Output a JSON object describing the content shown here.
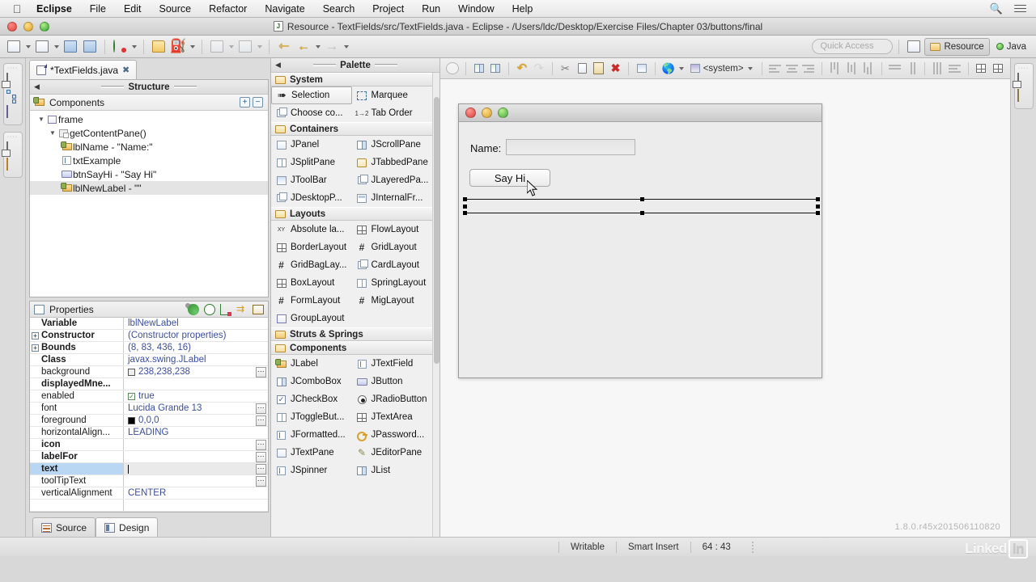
{
  "menubar": {
    "apple": "apple-logo",
    "items": [
      "Eclipse",
      "File",
      "Edit",
      "Source",
      "Refactor",
      "Navigate",
      "Search",
      "Project",
      "Run",
      "Window",
      "Help"
    ],
    "right_icons": [
      "search-icon",
      "list-icon"
    ]
  },
  "window": {
    "title": "Resource - TextFields/src/TextFields.java - Eclipse - /Users/ldc/Desktop/Exercise Files/Chapter 03/buttons/final",
    "file_badge": "J"
  },
  "toolbar": {
    "quick_access_placeholder": "Quick Access",
    "perspectives": [
      {
        "label": "Resource",
        "active": true
      },
      {
        "label": "Java",
        "active": false
      }
    ]
  },
  "editor": {
    "tab_label": "*TextFields.java",
    "close_glyph": "✖",
    "bottom_tabs": [
      {
        "label": "Source",
        "active": false
      },
      {
        "label": "Design",
        "active": true
      }
    ],
    "version": "1.8.0.r45x201506110820"
  },
  "structure": {
    "header": "Structure",
    "view_title": "Components",
    "expand_all": "+",
    "collapse_all": "−",
    "tree": [
      {
        "label": "frame",
        "depth": 0,
        "twisty": "▼",
        "icon": "frame-icon",
        "selected": false
      },
      {
        "label": "getContentPane()",
        "depth": 1,
        "twisty": "▼",
        "icon": "content-pane-icon",
        "selected": false
      },
      {
        "label": "lblName - \"Name:\"",
        "depth": 2,
        "twisty": "",
        "icon": "jlabel-icon",
        "selected": false
      },
      {
        "label": "txtExample",
        "depth": 2,
        "twisty": "",
        "icon": "jtextfield-icon",
        "selected": false
      },
      {
        "label": "btnSayHi - \"Say Hi\"",
        "depth": 2,
        "twisty": "",
        "icon": "jbutton-icon",
        "selected": false
      },
      {
        "label": "lblNewLabel - \"\"",
        "depth": 2,
        "twisty": "",
        "icon": "jlabel-icon",
        "selected": true
      }
    ]
  },
  "properties": {
    "title": "Properties",
    "rows": [
      {
        "name": "Variable",
        "value": "lblNewLabel",
        "bold": true,
        "expand": false,
        "ellipsis": false,
        "widget": "none",
        "selected": false
      },
      {
        "name": "Constructor",
        "value": "(Constructor properties)",
        "bold": true,
        "expand": true,
        "ellipsis": false,
        "widget": "none",
        "selected": false
      },
      {
        "name": "Bounds",
        "value": "(8, 83, 436, 16)",
        "bold": true,
        "expand": true,
        "ellipsis": false,
        "widget": "none",
        "selected": false
      },
      {
        "name": "Class",
        "value": "javax.swing.JLabel",
        "bold": true,
        "expand": false,
        "ellipsis": false,
        "widget": "none",
        "selected": false
      },
      {
        "name": "background",
        "value": "238,238,238",
        "bold": false,
        "expand": false,
        "ellipsis": true,
        "widget": "swatch",
        "selected": false
      },
      {
        "name": "displayedMne...",
        "value": "",
        "bold": true,
        "expand": false,
        "ellipsis": false,
        "widget": "none",
        "selected": false
      },
      {
        "name": "enabled",
        "value": "true",
        "bold": false,
        "expand": false,
        "ellipsis": false,
        "widget": "checkbox",
        "selected": false
      },
      {
        "name": "font",
        "value": "Lucida Grande 13",
        "bold": false,
        "expand": false,
        "ellipsis": true,
        "widget": "none",
        "selected": false
      },
      {
        "name": "foreground",
        "value": "0,0,0",
        "bold": false,
        "expand": false,
        "ellipsis": true,
        "widget": "swatch-black",
        "selected": false
      },
      {
        "name": "horizontalAlign...",
        "value": "LEADING",
        "bold": false,
        "expand": false,
        "ellipsis": false,
        "widget": "none",
        "selected": false
      },
      {
        "name": "icon",
        "value": "",
        "bold": true,
        "expand": false,
        "ellipsis": true,
        "widget": "none",
        "selected": false
      },
      {
        "name": "labelFor",
        "value": "",
        "bold": true,
        "expand": false,
        "ellipsis": true,
        "widget": "none",
        "selected": false
      },
      {
        "name": "text",
        "value": "",
        "bold": true,
        "expand": false,
        "ellipsis": true,
        "widget": "caret",
        "selected": true
      },
      {
        "name": "toolTipText",
        "value": "",
        "bold": false,
        "expand": false,
        "ellipsis": true,
        "widget": "none",
        "selected": false
      },
      {
        "name": "verticalAlignment",
        "value": "CENTER",
        "bold": false,
        "expand": false,
        "ellipsis": false,
        "widget": "none",
        "selected": false
      }
    ]
  },
  "palette": {
    "header": "Palette",
    "categories": [
      {
        "name": "System",
        "items": [
          {
            "label": "Selection",
            "icon": "pointer-icon",
            "selected": true
          },
          {
            "label": "Marquee",
            "icon": "marquee-icon",
            "selected": false
          },
          {
            "label": "Choose co...",
            "icon": "choose-component-icon",
            "selected": false
          },
          {
            "label": "Tab Order",
            "icon": "tab-order-icon",
            "selected": false
          }
        ]
      },
      {
        "name": "Containers",
        "items": [
          {
            "label": "JPanel",
            "icon": "jpanel-icon"
          },
          {
            "label": "JScrollPane",
            "icon": "jscrollpane-icon"
          },
          {
            "label": "JSplitPane",
            "icon": "jsplitpane-icon"
          },
          {
            "label": "JTabbedPane",
            "icon": "jtabbedpane-icon"
          },
          {
            "label": "JToolBar",
            "icon": "jtoolbar-icon"
          },
          {
            "label": "JLayeredPa...",
            "icon": "jlayeredpane-icon"
          },
          {
            "label": "JDesktopP...",
            "icon": "jdesktoppane-icon"
          },
          {
            "label": "JInternalFr...",
            "icon": "jinternalframe-icon"
          }
        ]
      },
      {
        "name": "Layouts",
        "items": [
          {
            "label": "Absolute la...",
            "icon": "absolute-layout-icon"
          },
          {
            "label": "FlowLayout",
            "icon": "flowlayout-icon"
          },
          {
            "label": "BorderLayout",
            "icon": "borderlayout-icon"
          },
          {
            "label": "GridLayout",
            "icon": "gridlayout-icon"
          },
          {
            "label": "GridBagLay...",
            "icon": "gridbaglayout-icon"
          },
          {
            "label": "CardLayout",
            "icon": "cardlayout-icon"
          },
          {
            "label": "BoxLayout",
            "icon": "boxlayout-icon"
          },
          {
            "label": "SpringLayout",
            "icon": "springlayout-icon"
          },
          {
            "label": "FormLayout",
            "icon": "formlayout-icon"
          },
          {
            "label": "MigLayout",
            "icon": "miglayout-icon"
          },
          {
            "label": "GroupLayout",
            "icon": "grouplayout-icon"
          }
        ]
      },
      {
        "name": "Struts & Springs",
        "items": []
      },
      {
        "name": "Components",
        "items": [
          {
            "label": "JLabel",
            "icon": "jlabel-icon"
          },
          {
            "label": "JTextField",
            "icon": "jtextfield-icon"
          },
          {
            "label": "JComboBox",
            "icon": "jcombobox-icon"
          },
          {
            "label": "JButton",
            "icon": "jbutton-icon"
          },
          {
            "label": "JCheckBox",
            "icon": "jcheckbox-icon"
          },
          {
            "label": "JRadioButton",
            "icon": "jradiobutton-icon"
          },
          {
            "label": "JToggleBut...",
            "icon": "jtogglebutton-icon"
          },
          {
            "label": "JTextArea",
            "icon": "jtextarea-icon"
          },
          {
            "label": "JFormatted...",
            "icon": "jformattedtextfield-icon"
          },
          {
            "label": "JPassword...",
            "icon": "jpasswordfield-icon"
          },
          {
            "label": "JTextPane",
            "icon": "jtextpane-icon"
          },
          {
            "label": "JEditorPane",
            "icon": "jeditorpane-icon"
          },
          {
            "label": "JSpinner",
            "icon": "jspinner-icon"
          },
          {
            "label": "JList",
            "icon": "jlist-icon"
          }
        ]
      }
    ]
  },
  "design_toolbar": {
    "lookandfeel": "<system>"
  },
  "preview": {
    "name_label": "Name:",
    "textfield_value": "",
    "button_label": "Say Hi",
    "selected_component": "lblNewLabel"
  },
  "statusbar": {
    "writable": "Writable",
    "insert_mode": "Smart Insert",
    "position": "64 : 43",
    "watermark": "Linked",
    "watermark_box": "in"
  }
}
